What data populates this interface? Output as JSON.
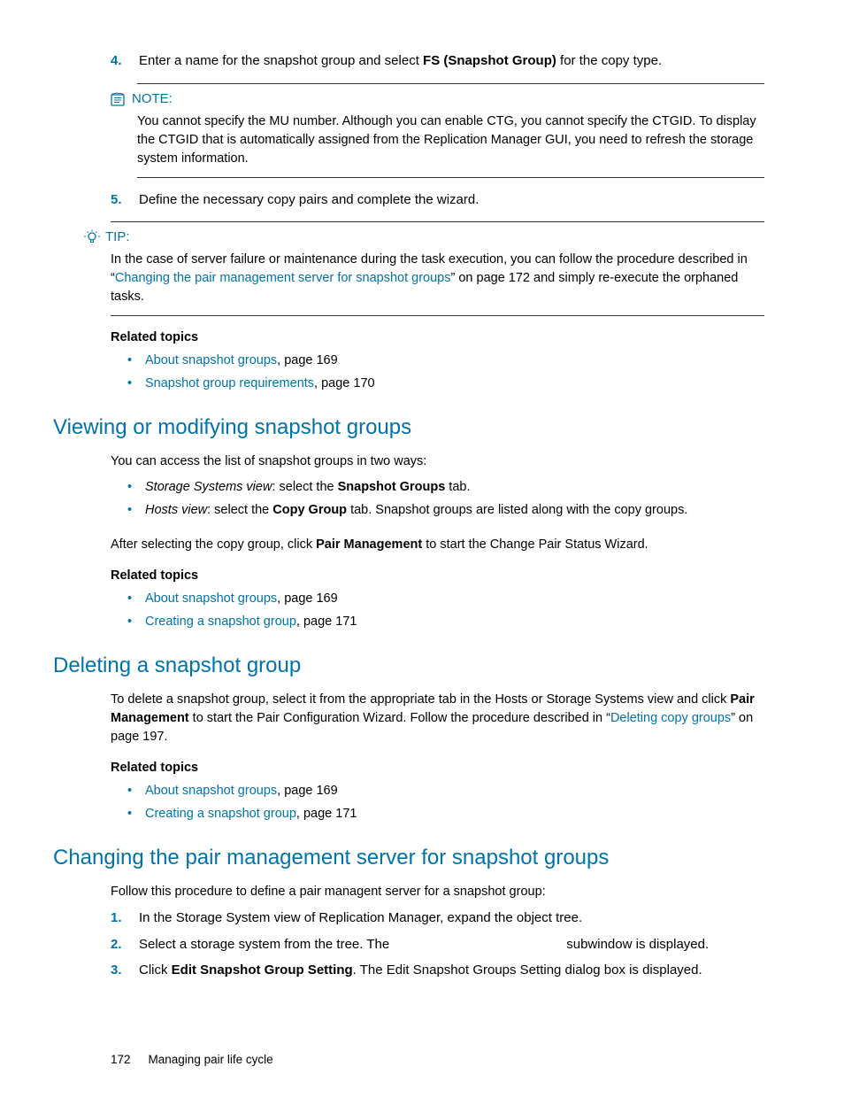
{
  "step4": {
    "num": "4.",
    "pre": "Enter a name for the snapshot group and select ",
    "bold": "FS (Snapshot Group)",
    "post": " for the copy type."
  },
  "note": {
    "label": "NOTE:",
    "body": "You cannot specify the MU number. Although you can enable CTG, you cannot specify the CTGID. To display the CTGID that is automatically assigned from the Replication Manager GUI, you need to refresh the storage system information."
  },
  "step5": {
    "num": "5.",
    "text": "Define the necessary copy pairs and complete the wizard."
  },
  "tip": {
    "label": "TIP:",
    "pre": "In the case of server failure or maintenance during the task execution, you can follow the procedure described in “",
    "link": "Changing the pair management server for snapshot groups",
    "post": "” on page 172 and simply re-execute the orphaned tasks."
  },
  "related_label": "Related topics",
  "rel1": {
    "a": {
      "link": "About snapshot groups",
      "rest": ", page 169"
    },
    "b": {
      "link": "Snapshot group requirements",
      "rest": ", page 170"
    }
  },
  "sec_view": {
    "title": "Viewing or modifying snapshot groups",
    "intro": "You can access the list of snapshot groups in two ways:",
    "b1": {
      "ital": "Storage Systems view",
      "pre": ": select the ",
      "bold": "Snapshot Groups",
      "post": " tab."
    },
    "b2": {
      "ital": "Hosts view",
      "pre": ": select the ",
      "bold": "Copy Group",
      "post": " tab. Snapshot groups are listed along with the copy groups."
    },
    "after_pre": "After selecting the copy group, click ",
    "after_bold": "Pair Management",
    "after_post": " to start the Change Pair Status Wizard.",
    "rel": {
      "a": {
        "link": "About snapshot groups",
        "rest": ", page 169"
      },
      "b": {
        "link": "Creating a snapshot group",
        "rest": ", page 171"
      }
    }
  },
  "sec_del": {
    "title": "Deleting a snapshot group",
    "p_pre": "To delete a snapshot group, select it from the appropriate tab in the Hosts or Storage Systems view and click ",
    "p_bold": "Pair Management",
    "p_mid": " to start the Pair Configuration Wizard. Follow the procedure described in “",
    "p_link": "Deleting copy groups",
    "p_post": "” on page 197.",
    "rel": {
      "a": {
        "link": "About snapshot groups",
        "rest": ", page 169"
      },
      "b": {
        "link": "Creating a snapshot group",
        "rest": ", page 171"
      }
    }
  },
  "sec_change": {
    "title": "Changing the pair management server for snapshot groups",
    "intro": "Follow this procedure to define a pair managent server for a snapshot group:",
    "s1": {
      "num": "1.",
      "text": "In the Storage System view of Replication Manager, expand the object tree."
    },
    "s2": {
      "num": "2.",
      "pre": "Select a storage system from the tree. The ",
      "gap": "                                               ",
      "post": "subwindow is displayed."
    },
    "s3": {
      "num": "3.",
      "pre": "Click ",
      "bold": "Edit Snapshot Group Setting",
      "post": ". The Edit Snapshot Groups Setting dialog box is displayed."
    }
  },
  "footer": {
    "page": "172",
    "title": "Managing pair life cycle"
  }
}
